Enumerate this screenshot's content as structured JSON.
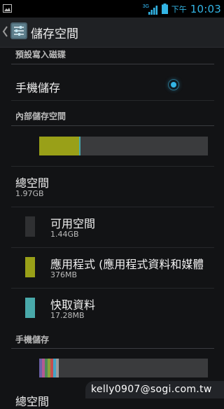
{
  "status_bar": {
    "network": "3G",
    "ampm": "下午",
    "time": "10:03"
  },
  "action_bar": {
    "title": "儲存空間",
    "back_icon": "chevron-left-icon",
    "app_icon": "settings-sliders-icon"
  },
  "default_write_disk": {
    "header": "預設寫入磁碟",
    "option_label": "手機儲存",
    "selected": true
  },
  "internal_storage": {
    "header": "內部儲存空間",
    "usage_bar_fractions": {
      "apps": 0.2375,
      "cache": 0.0088,
      "available": 0.7537
    },
    "total": {
      "label": "總空間",
      "value": "1.97GB"
    },
    "items": [
      {
        "label": "可用空間",
        "value": "1.44GB",
        "color": "#2f3032"
      },
      {
        "label": "應用程式 (應用程式資料和媒體",
        "value": "376MB",
        "color": "#99a018"
      },
      {
        "label": "快取資料",
        "value": "17.28MB",
        "color": "#49a9aa"
      }
    ]
  },
  "phone_storage": {
    "header": "手機儲存",
    "usage_bar_colors": [
      "#6b60a8",
      "#b35a92",
      "#4d8a58",
      "#8ca23a",
      "#c44f4f",
      "#43a5c6",
      "#9c9c9c"
    ],
    "partial_next_label": "總空間"
  },
  "watermark": "kelly0907@sogi.com.tw",
  "colors": {
    "accent": "#33b5e5",
    "background": "#121315"
  }
}
